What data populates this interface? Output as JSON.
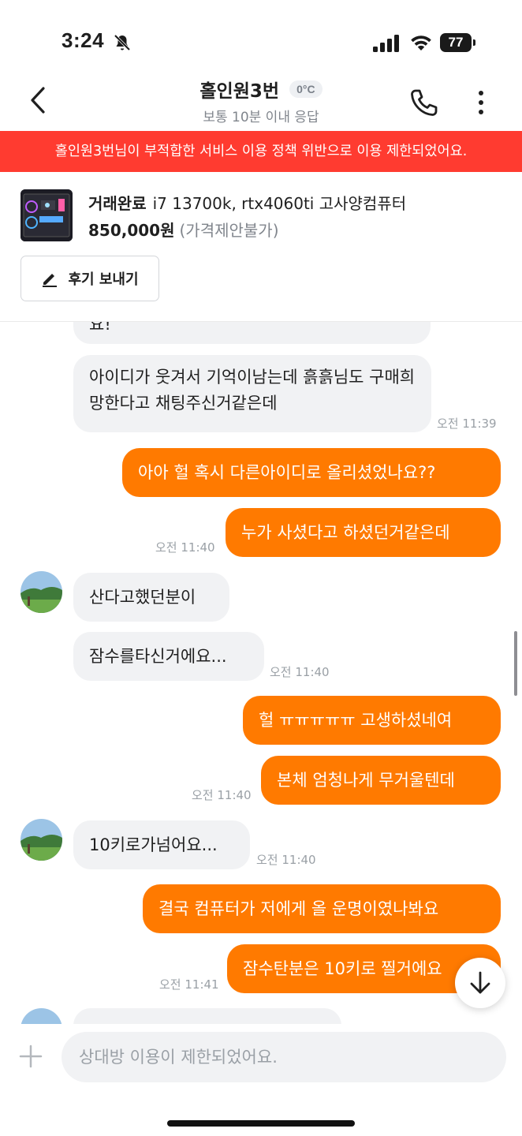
{
  "status_bar": {
    "time": "3:24",
    "battery": "77"
  },
  "header": {
    "title": "홀인원3번",
    "temperature": "0°C",
    "subtitle": "보통 10분 이내 응답"
  },
  "banner": {
    "text": "홀인원3번님이 부적합한 서비스 이용 정책 위반으로 이용 제한되었어요."
  },
  "product": {
    "status": "거래완료",
    "title": "i7 13700k, rtx4060ti 고사양컴퓨터",
    "price": "850,000원",
    "price_note": "(가격제안불가)",
    "review_button": "후기 보내기"
  },
  "messages": [
    {
      "side": "in",
      "text": "요!"
    },
    {
      "side": "in",
      "text": "아이디가 웃겨서 기억이남는데 흙흙님도 구매희망한다고 채팅주신거같은데",
      "time": "오전 11:39"
    },
    {
      "side": "out",
      "text": "아아 헐 혹시 다른아이디로 올리셨었나요??"
    },
    {
      "side": "out",
      "text": "누가 사셨다고 하셨던거같은데",
      "time": "오전 11:40"
    },
    {
      "side": "in",
      "text": "산다고했던분이"
    },
    {
      "side": "in",
      "text": "잠수를타신거에요...",
      "time": "오전 11:40"
    },
    {
      "side": "out",
      "text": "헐 ㅠㅠㅠㅠㅠ 고생하셨네여"
    },
    {
      "side": "out",
      "text": "본체 엄청나게 무거울텐데",
      "time": "오전 11:40"
    },
    {
      "side": "in",
      "text": "10키로가넘어요...",
      "time": "오전 11:40"
    },
    {
      "side": "out",
      "text": "결국 컴퓨터가 저에게 올 운명이였나봐요"
    },
    {
      "side": "out",
      "text": "잠수탄분은 10키로 찔거에요",
      "time": "오전 11:41"
    }
  ],
  "composer": {
    "placeholder": "상대방 이용이 제한되었어요."
  },
  "colors": {
    "accent": "#ff7a00",
    "banner": "#ff3b30",
    "incoming_bubble": "#f1f2f4"
  }
}
